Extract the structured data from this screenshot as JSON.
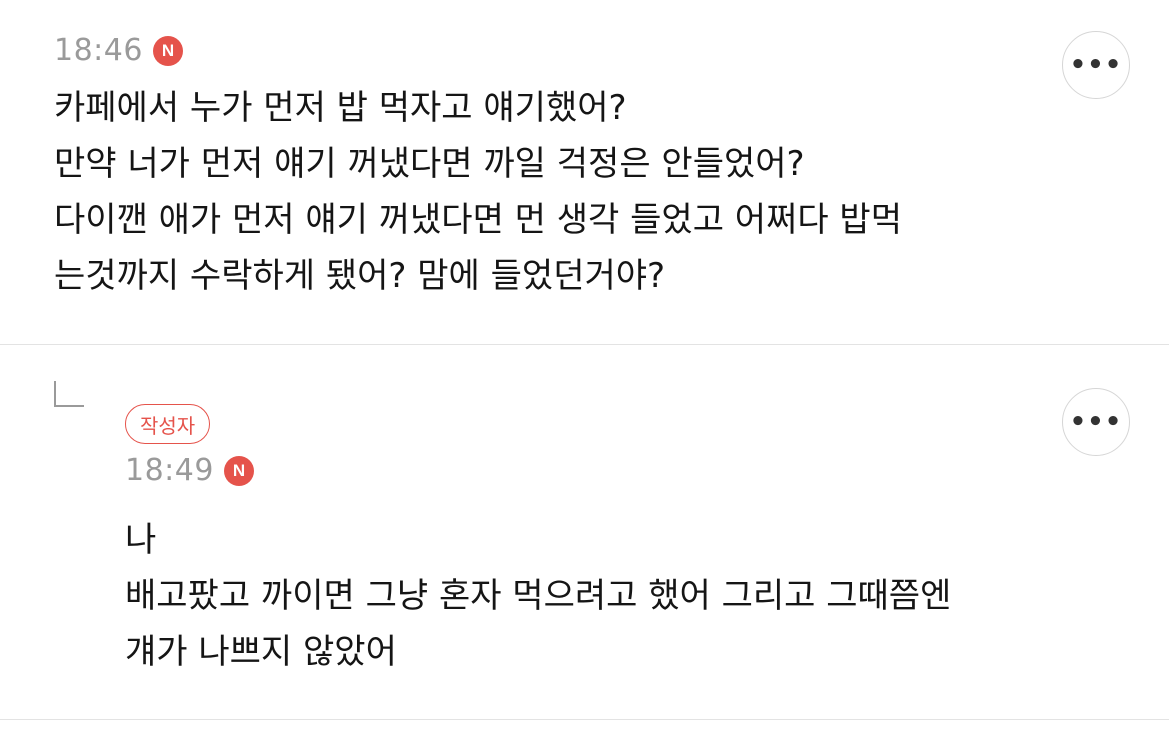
{
  "comments": [
    {
      "time": "18:46",
      "new_badge": "N",
      "lines": [
        "카페에서 누가 먼저 밥 먹자고 얘기했어?",
        "만약 너가 먼저 얘기 꺼냈다면 까일 걱정은 안들었어?",
        "다이깬 애가 먼저 얘기 꺼냈다면 먼 생각 들었고 어쩌다 밥먹",
        "는것까지 수락하게 됐어? 맘에 들었던거야?"
      ],
      "more_icon": "more-horizontal-icon"
    },
    {
      "author_badge": "작성자",
      "time": "18:49",
      "new_badge": "N",
      "lines": [
        "나",
        "배고팠고 까이면 그냥 혼자 먹으려고 했어 그리고 그때쯤엔",
        "걔가 나쁘지 않았어"
      ],
      "reply_icon": "reply-arrow-icon",
      "more_icon": "more-horizontal-icon"
    }
  ],
  "colors": {
    "accent": "#e5534b",
    "time": "#9a9a9a",
    "divider": "#e3e3e3"
  }
}
